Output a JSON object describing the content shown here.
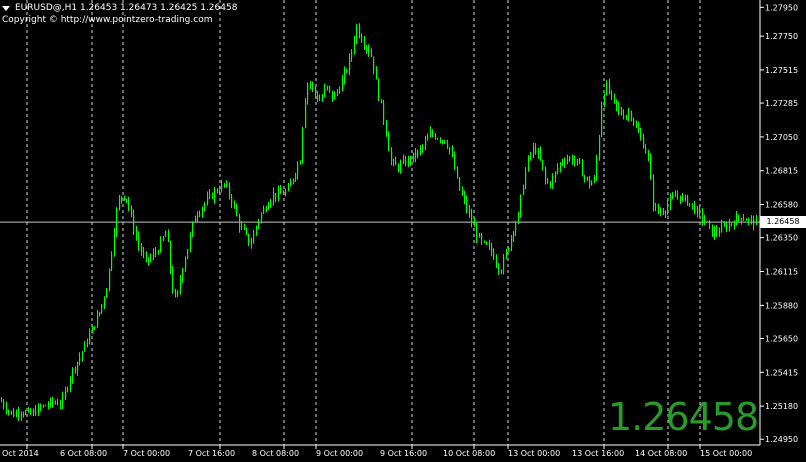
{
  "header": {
    "symbol_line": "EURUSD@,H1  1.26453 1.26473 1.26425 1.26458",
    "copyright": "Copyright © http://www.pointzero-trading.com"
  },
  "current_price": "1.26458",
  "big_price": "1.26458",
  "colors": {
    "background": "#000000",
    "candles": "#00ff00",
    "grid": "#ffffff",
    "big_price": "#2a9a2a"
  },
  "chart_data": {
    "type": "candlestick",
    "ylim": [
      1.2491,
      1.2798
    ],
    "y_ticks": [
      "1.27950",
      "1.27750",
      "1.27515",
      "1.27285",
      "1.27050",
      "1.26815",
      "1.26580",
      "1.26350",
      "1.26115",
      "1.25880",
      "1.25650",
      "1.25415",
      "1.25180",
      "1.24950"
    ],
    "x_ticks": [
      "Oct 2014",
      "6 Oct 08:00",
      "7 Oct 00:00",
      "7 Oct 16:00",
      "8 Oct 08:00",
      "9 Oct 00:00",
      "9 Oct 16:00",
      "10 Oct 08:00",
      "13 Oct 00:00",
      "13 Oct 16:00",
      "14 Oct 08:00",
      "15 Oct 00:00"
    ],
    "series_path": [
      [
        0,
        1.2522
      ],
      [
        6,
        1.2517
      ],
      [
        12,
        1.2512
      ],
      [
        20,
        1.2515
      ],
      [
        30,
        1.2512
      ],
      [
        40,
        1.2517
      ],
      [
        50,
        1.252
      ],
      [
        62,
        1.2521
      ],
      [
        70,
        1.254
      ],
      [
        80,
        1.2553
      ],
      [
        92,
        1.2572
      ],
      [
        100,
        1.2585
      ],
      [
        106,
        1.26
      ],
      [
        110,
        1.2618
      ],
      [
        115,
        1.265
      ],
      [
        120,
        1.2665
      ],
      [
        126,
        1.2663
      ],
      [
        132,
        1.2645
      ],
      [
        138,
        1.263
      ],
      [
        145,
        1.2618
      ],
      [
        152,
        1.2622
      ],
      [
        160,
        1.263
      ],
      [
        166,
        1.264
      ],
      [
        172,
        1.26
      ],
      [
        176,
        1.259
      ],
      [
        182,
        1.2615
      ],
      [
        188,
        1.263
      ],
      [
        194,
        1.265
      ],
      [
        200,
        1.2655
      ],
      [
        208,
        1.2662
      ],
      [
        216,
        1.2668
      ],
      [
        224,
        1.2672
      ],
      [
        232,
        1.266
      ],
      [
        238,
        1.2645
      ],
      [
        244,
        1.2638
      ],
      [
        250,
        1.263
      ],
      [
        258,
        1.2648
      ],
      [
        266,
        1.2658
      ],
      [
        272,
        1.2665
      ],
      [
        280,
        1.2665
      ],
      [
        288,
        1.2668
      ],
      [
        294,
        1.268
      ],
      [
        300,
        1.269
      ],
      [
        304,
        1.273
      ],
      [
        308,
        1.2745
      ],
      [
        314,
        1.2735
      ],
      [
        320,
        1.273
      ],
      [
        326,
        1.274
      ],
      [
        332,
        1.2732
      ],
      [
        338,
        1.2738
      ],
      [
        344,
        1.2748
      ],
      [
        350,
        1.276
      ],
      [
        356,
        1.2782
      ],
      [
        360,
        1.2775
      ],
      [
        366,
        1.2768
      ],
      [
        372,
        1.276
      ],
      [
        376,
        1.2742
      ],
      [
        380,
        1.2728
      ],
      [
        386,
        1.2708
      ],
      [
        390,
        1.2688
      ],
      [
        396,
        1.2684
      ],
      [
        402,
        1.2686
      ],
      [
        410,
        1.269
      ],
      [
        418,
        1.2694
      ],
      [
        424,
        1.27
      ],
      [
        430,
        1.2707
      ],
      [
        438,
        1.2705
      ],
      [
        446,
        1.2702
      ],
      [
        452,
        1.269
      ],
      [
        458,
        1.267
      ],
      [
        464,
        1.266
      ],
      [
        470,
        1.2648
      ],
      [
        476,
        1.2638
      ],
      [
        482,
        1.263
      ],
      [
        488,
        1.2628
      ],
      [
        494,
        1.2622
      ],
      [
        500,
        1.2612
      ],
      [
        506,
        1.2625
      ],
      [
        512,
        1.264
      ],
      [
        518,
        1.265
      ],
      [
        522,
        1.267
      ],
      [
        528,
        1.269
      ],
      [
        534,
        1.2698
      ],
      [
        540,
        1.2688
      ],
      [
        546,
        1.2672
      ],
      [
        552,
        1.2675
      ],
      [
        558,
        1.2685
      ],
      [
        564,
        1.269
      ],
      [
        570,
        1.269
      ],
      [
        576,
        1.2688
      ],
      [
        582,
        1.268
      ],
      [
        588,
        1.2672
      ],
      [
        594,
        1.2675
      ],
      [
        598,
        1.27
      ],
      [
        602,
        1.2735
      ],
      [
        606,
        1.274
      ],
      [
        612,
        1.273
      ],
      [
        618,
        1.2723
      ],
      [
        624,
        1.272
      ],
      [
        630,
        1.2722
      ],
      [
        636,
        1.271
      ],
      [
        642,
        1.2702
      ],
      [
        648,
        1.269
      ],
      [
        652,
        1.266
      ],
      [
        658,
        1.2652
      ],
      [
        664,
        1.2655
      ],
      [
        670,
        1.266
      ],
      [
        676,
        1.2665
      ],
      [
        682,
        1.2662
      ],
      [
        688,
        1.266
      ],
      [
        694,
        1.2655
      ],
      [
        700,
        1.265
      ],
      [
        706,
        1.2645
      ],
      [
        712,
        1.2638
      ],
      [
        718,
        1.264
      ],
      [
        724,
        1.2642
      ],
      [
        730,
        1.2645
      ],
      [
        736,
        1.2648
      ],
      [
        742,
        1.265
      ],
      [
        748,
        1.2647
      ],
      [
        754,
        1.2646
      ]
    ]
  }
}
